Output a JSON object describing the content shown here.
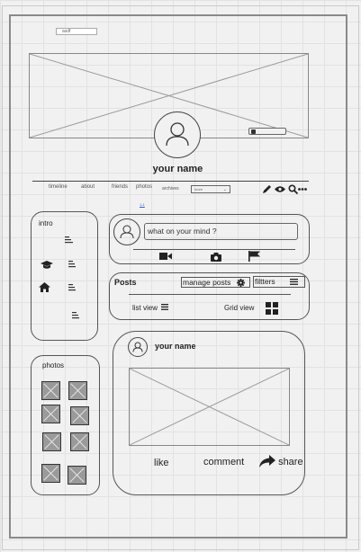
{
  "top_input": {
    "value": "asdf"
  },
  "profile": {
    "name": "your name"
  },
  "nav": {
    "items": [
      "timeline",
      "about",
      "friends",
      "photos",
      "archives"
    ],
    "more_select": "more",
    "tiny_link": "1-1"
  },
  "intro": {
    "title": "intro"
  },
  "composer": {
    "placeholder": "what on your mind ?"
  },
  "posts": {
    "title": "Posts",
    "manage_label": "manage posts",
    "filters_label": "filtters",
    "list_view_label": "list view",
    "grid_view_label": "Grid view"
  },
  "photos": {
    "title": "photos"
  },
  "post": {
    "author": "your name",
    "like_label": "like",
    "comment_label": "comment",
    "share_label": "share"
  }
}
